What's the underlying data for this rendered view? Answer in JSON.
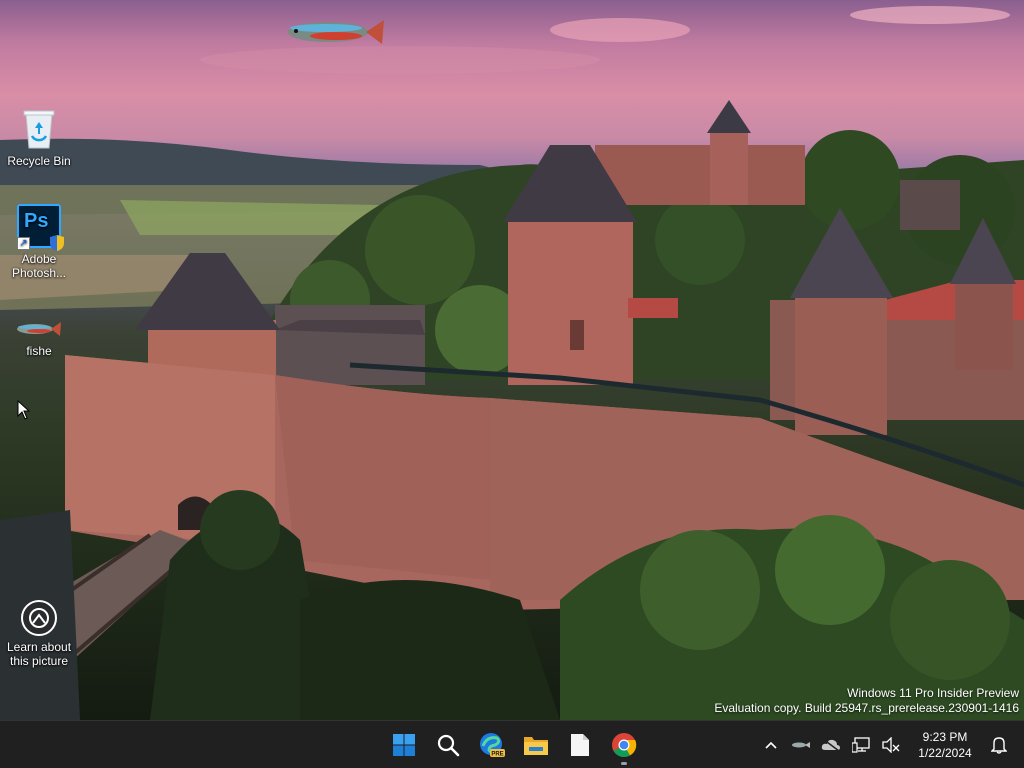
{
  "desktop": {
    "icons": [
      {
        "label": "Recycle Bin",
        "icon": "recycle-bin-icon"
      },
      {
        "label": "Adobe Photosh...",
        "icon": "photoshop-icon",
        "badge": "Ps"
      },
      {
        "label": "fishe",
        "icon": "fish-icon"
      },
      {
        "label": "Learn about this picture",
        "icon": "camera-icon"
      }
    ]
  },
  "watermark": {
    "line1": "Windows 11 Pro Insider Preview",
    "line2": "Evaluation copy. Build 25947.rs_prerelease.230901-1416"
  },
  "taskbar": {
    "apps": [
      {
        "name": "Start",
        "icon": "windows-start-icon"
      },
      {
        "name": "Search",
        "icon": "search-icon"
      },
      {
        "name": "Microsoft Edge Preview",
        "icon": "edge-preview-icon",
        "badge": "PRE"
      },
      {
        "name": "File Explorer",
        "icon": "folder-icon"
      },
      {
        "name": "Notepad",
        "icon": "document-icon"
      },
      {
        "name": "Google Chrome",
        "icon": "chrome-icon",
        "running": true
      }
    ],
    "tray": [
      {
        "name": "Show hidden icons",
        "icon": "chevron-up-icon"
      },
      {
        "name": "fishe",
        "icon": "fish-icon"
      },
      {
        "name": "OneDrive",
        "icon": "cloud-icon"
      },
      {
        "name": "Network",
        "icon": "network-icon"
      },
      {
        "name": "Volume",
        "icon": "speaker-muted-icon"
      }
    ],
    "clock": {
      "time": "9:23 PM",
      "date": "1/22/2024"
    },
    "notification_icon": "bell-icon"
  },
  "colors": {
    "taskbar_bg": "#202020",
    "accent_blue": "#0078d4",
    "photoshop_blue": "#31a8ff"
  }
}
